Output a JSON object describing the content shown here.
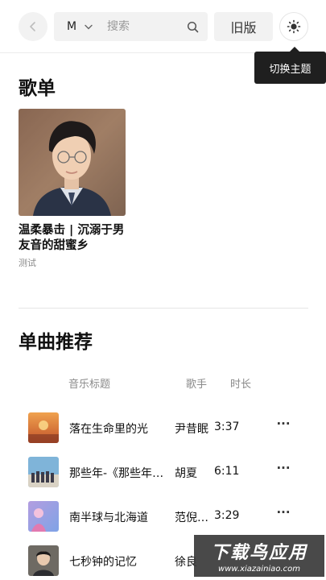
{
  "header": {
    "search_select_value": "M",
    "search_placeholder": "搜索",
    "old_version_label": "旧版",
    "theme_tooltip": "切换主题"
  },
  "playlists": {
    "title": "歌单",
    "items": [
      {
        "name": "温柔暴击 | 沉溺于男友音的甜蜜乡",
        "tag": "测试"
      }
    ]
  },
  "songs": {
    "title": "单曲推荐",
    "columns": {
      "title": "音乐标题",
      "artist": "歌手",
      "duration": "时长"
    },
    "rows": [
      {
        "title": "落在生命里的光",
        "artist": "尹昔眠",
        "duration": "3:37",
        "more": "···"
      },
      {
        "title": "那些年-《那些年，我们一起追的女孩》",
        "artist": "胡夏",
        "duration": "6:11",
        "more": "···"
      },
      {
        "title": "南半球与北海道",
        "artist": "范倪Liu",
        "duration": "3:29",
        "more": "···"
      },
      {
        "title": "七秒钟的记忆",
        "artist": "徐良",
        "duration": "",
        "more": ""
      }
    ]
  },
  "watermark": {
    "main": "下载鸟应用",
    "sub": "www.xiazainiao.com"
  },
  "icons": {
    "back": "chevron-left-icon",
    "dropdown": "chevron-down-icon",
    "search": "search-icon",
    "theme": "sun-icon",
    "more": "ellipsis-icon"
  },
  "colors": {
    "control_bg": "#f2f2f2",
    "tooltip_bg": "#1f1f1f",
    "muted_text": "#8a8a8a"
  }
}
